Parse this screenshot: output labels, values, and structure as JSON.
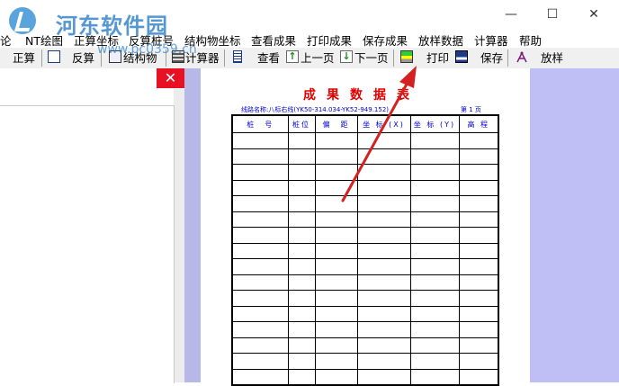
{
  "watermark": {
    "site": "河东软件园",
    "url": "www.pc0359.cn"
  },
  "window_controls": {
    "minimize": "—",
    "maximize": "☐",
    "close": "✕"
  },
  "menu": [
    {
      "label": "论"
    },
    {
      "label": "NT绘图"
    },
    {
      "label": "正算坐标"
    },
    {
      "label": "反算桩号"
    },
    {
      "label": "结构物坐标"
    },
    {
      "label": "查看成果"
    },
    {
      "label": "打印成果"
    },
    {
      "label": "保存成果"
    },
    {
      "label": "放样数据"
    },
    {
      "label": "计算器"
    },
    {
      "label": "帮助"
    }
  ],
  "toolbar": {
    "zheng_suan": "正算",
    "fan_suan": "反算",
    "structure": "结构物",
    "calculator": "计算器",
    "view": "查看",
    "prev_page": "上一页",
    "next_page": "下一页",
    "print": "打印",
    "save": "保存",
    "stakeout": "放样"
  },
  "left_panel": {
    "close": "✕"
  },
  "report": {
    "title": "成果数据表",
    "route": "线路名称:八标右线(YK50-314.034-YK52-949.152)",
    "page": "第 1 页",
    "headers": [
      "桩　号",
      "桩位",
      "偏　距",
      "坐 标 (X)",
      "坐 标 (Y)",
      "高 程"
    ]
  },
  "colors": {
    "title_red": "#e00000",
    "header_blue": "#0000cc",
    "side_bg": "#bfbff5",
    "close_red": "#e81123",
    "arrow_red": "#d42020"
  }
}
